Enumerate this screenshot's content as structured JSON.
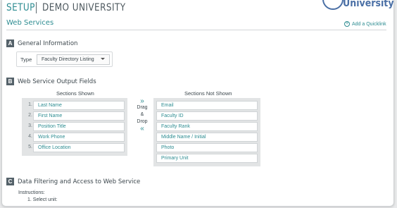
{
  "header": {
    "app_title": "SETUP",
    "institution": "DEMO UNIVERSITY",
    "logo_text": "University",
    "logo_icon": "shield-icon"
  },
  "page": {
    "title": "Web Services",
    "quicklink_label": "Add a Quicklink",
    "quicklink_icon": "plus-circle-icon"
  },
  "sections": {
    "a": {
      "letter": "A",
      "title": "General Information"
    },
    "b": {
      "letter": "B",
      "title": "Web Service Output Fields"
    },
    "c": {
      "letter": "C",
      "title": "Data Filtering and Access to Web Service"
    }
  },
  "general": {
    "type_label": "Type",
    "type_value": "Faculty Directory Listing"
  },
  "fields": {
    "shown_header": "Sections Shown",
    "not_shown_header": "Sections Not Shown",
    "drag_top": "Drag",
    "drag_mid": "&",
    "drag_bottom": "Drop",
    "arrow_right": "»",
    "arrow_left": "«",
    "shown": [
      {
        "num": "1.",
        "label": "Last Name"
      },
      {
        "num": "2.",
        "label": "First Name"
      },
      {
        "num": "3.",
        "label": "Position Title"
      },
      {
        "num": "4.",
        "label": "Work Phone"
      },
      {
        "num": "5.",
        "label": "Office Location"
      }
    ],
    "not_shown": [
      "Email",
      "Faculty ID",
      "Faculty Rank",
      "Middle Name / Initial",
      "Photo",
      "Primary Unit"
    ]
  },
  "filtering": {
    "instructions_label": "Instructions:",
    "step_1": "1. Select unit:"
  },
  "colors": {
    "accent": "#2d8c91",
    "section_letter_bg": "#55626a",
    "panel_bg": "#e2e4e5"
  }
}
